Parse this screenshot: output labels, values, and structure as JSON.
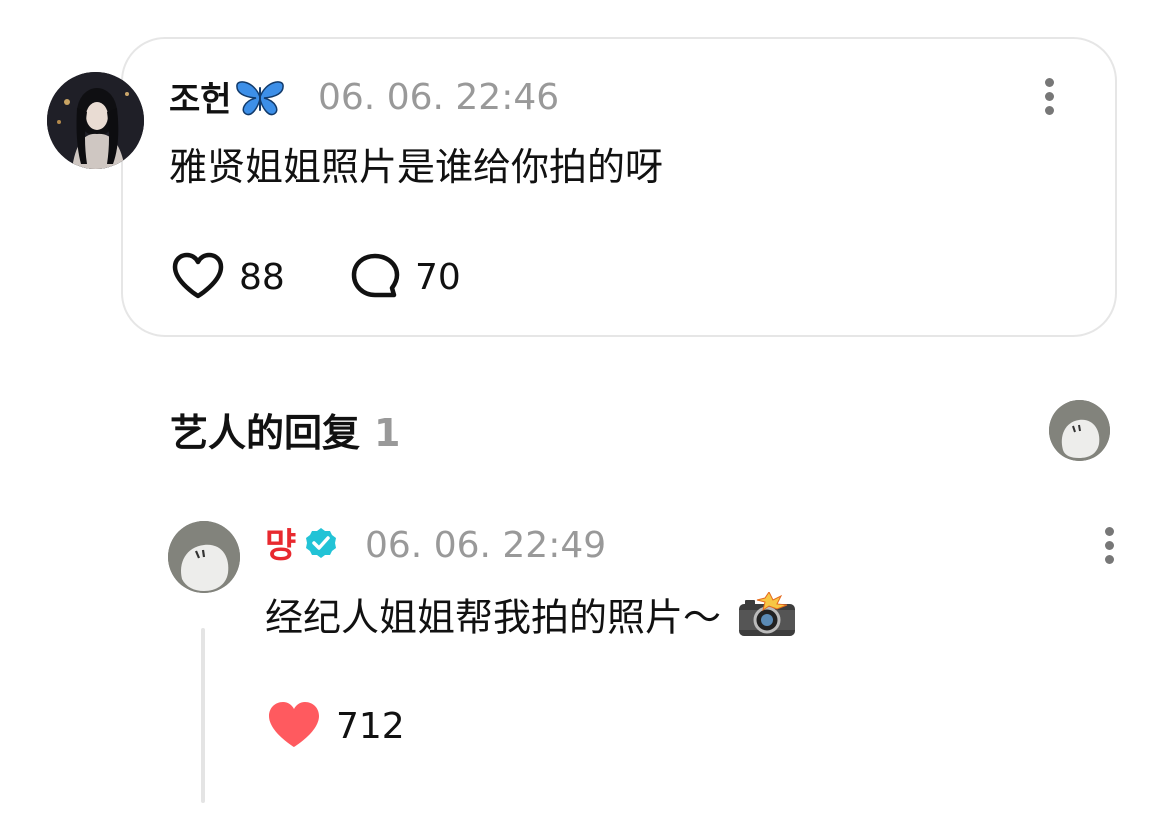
{
  "comment": {
    "username": "조헌",
    "username_emoji": "🦋",
    "timestamp": "06. 06. 22:46",
    "text": "雅贤姐姐照片是谁给你拍的呀",
    "likes": "88",
    "replies": "70"
  },
  "artist_replies": {
    "title": "艺人的回复",
    "count": "1"
  },
  "reply": {
    "username": "먕",
    "timestamp": "06. 06. 22:49",
    "text": "经纪人姐姐帮我拍的照片～",
    "text_emoji": "📸",
    "likes": "712"
  },
  "colors": {
    "artist_name": "#e8292f",
    "verified_badge": "#22c3d6",
    "liked_heart": "#ff5a5f",
    "timestamp": "#999999"
  },
  "icons": [
    "heart-outline-icon",
    "comment-bubble-icon",
    "more-vertical-icon",
    "verified-badge-icon",
    "heart-filled-icon",
    "butterfly-emoji",
    "camera-flash-emoji"
  ]
}
